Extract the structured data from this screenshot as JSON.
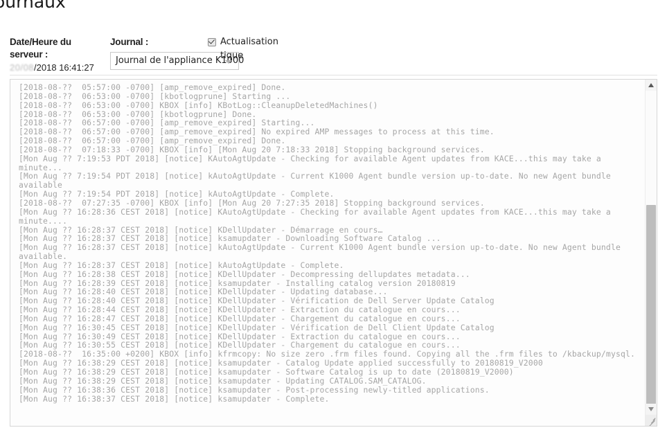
{
  "page": {
    "title": "ournaux"
  },
  "controls": {
    "server_datetime_label": "Date/Heure du serveur :",
    "server_datetime_redacted": "20/08",
    "server_datetime_value": "/2018 16:41:27",
    "journal_label": "Journal :",
    "journal_selected": "Journal de l'appliance K1000",
    "journal_options": [
      "Journal de l'appliance K1000"
    ],
    "autorefresh_label_line1": "Actualisation",
    "autorefresh_label_line2": "tique",
    "autorefresh_checked": true
  },
  "log": {
    "lines": [
      "[2018-08-??  05:57:00 -0700] [amp_remove_expired] Done.",
      "[2018-08-??  06:53:00 -0700] [kbotlogprune] Starting ...",
      "[2018-08-??  06:53:00 -0700] KBOX [info] KBotLog::CleanupDeletedMachines()",
      "[2018-08-??  06:53:00 -0700] [kbotlogprune] Done.",
      "[2018-08-??  06:57:00 -0700] [amp_remove_expired] Starting...",
      "[2018-08-??  06:57:00 -0700] [amp_remove_expired] No expired AMP messages to process at this time.",
      "[2018-08-??  06:57:00 -0700] [amp_remove_expired] Done.",
      "[2018-08-??  07:18:33 -0700] KBOX [info] [Mon Aug 20 7:18:33 2018] Stopping background services.",
      "[Mon Aug ?? 7:19:53 PDT 2018] [notice] KAutoAgtUpdate - Checking for available Agent updates from KACE...this may take a minute...",
      "[Mon Aug ?? 7:19:54 PDT 2018] [notice] kAutoAgtUpdate - Current K1000 Agent bundle version up-to-date. No new Agent bundle available",
      "[Mon Aug ?? 7:19:54 PDT 2018] [notice] kAutoAgtUpdate - Complete.",
      "[2018-08-??  07:27:35 -0700] KBOX [info] [Mon Aug 20 7:27:35 2018] Stopping background services.",
      "[Mon Aug ?? 16:28:36 CEST 2018] [notice] KAutoAgtUpdate - Checking for available Agent updates from KACE...this may take a minute....",
      "[Mon Aug ?? 16:28:37 CEST 2018] [notice] KDellUpdater - Démarrage en cours…",
      "[Mon Aug ?? 16:28:37 CEST 2018] [notice] ksamupdater - Downloading Software Catalog ...",
      "[Mon Aug ?? 16:28:37 CEST 2018] [notice] kAutoAgtUpdate - Current K1000 Agent bundle version up-to-date. No new Agent bundle available.",
      "[Mon Aug ?? 16:28:37 CEST 2018] [notice] kAutoAgtUpdate - Complete.",
      "[Mon Aug ?? 16:28:38 CEST 2018] [notice] KDellUpdater - Decompressing dellupdates metadata...",
      "[Mon Aug ?? 16:28:39 CEST 2018] [notice] ksamupdater - Installing catalog version 20180819",
      "[Mon Aug ?? 16:28:40 CEST 2018] [notice] KDellUpdater - Updating database...",
      "[Mon Aug ?? 16:28:40 CEST 2018] [notice] KDellUpdater - Vérification de Dell Server Update Catalog",
      "[Mon Aug ?? 16:28:44 CEST 2018] [notice] KDellUpdater - Extraction du catalogue en cours...",
      "[Mon Aug ?? 16:28:47 CEST 2018] [notice] KDellUpdater - Chargement du catalogue en cours...",
      "[Mon Aug ?? 16:30:45 CEST 2018] [notice] KDellUpdater - Vérification de Dell Client Update Catalog",
      "[Mon Aug ?? 16:30:49 CEST 2018] [notice] KDellUpdater - Extraction du catalogue en cours...",
      "[Mon Aug ?? 16:30:55 CEST 2018] [notice] KDellUpdater - Chargement du catalogue en cours...",
      "[2018-08-??  16:35:00 +0200] KBOX [info] kfrmcopy: No size zero .frm files found. Copying all the .frm files to /kbackup/mysql.",
      "[Mon Aug ?? 16:38:29 CEST 2018] [notice] ksamupdater - Catalog Update applied successfully to 20180819_V2000",
      "[Mon Aug ?? 16:38:29 CEST 2018] [notice] ksamupdater - Software Catalog is up to date (20180819_V2000)",
      "[Mon Aug ?? 16:38:29 CEST 2018] [notice] ksamupdater - Updating CATALOG.SAM_CATALOG.",
      "[Mon Aug ?? 16:38:36 CEST 2018] [notice] ksamupdater - Post-processing newly-titled applications.",
      "[Mon Aug ?? 16:38:37 CEST 2018] [notice] ksamupdater - Complete."
    ]
  },
  "scrollbar": {
    "up_arrow": "triangle-up-icon",
    "down_arrow": "triangle-down-icon"
  },
  "colors": {
    "log_text": "#a6a6a6",
    "panel_border": "#d6d6d6",
    "scroll_thumb": "#bdbdbd"
  }
}
